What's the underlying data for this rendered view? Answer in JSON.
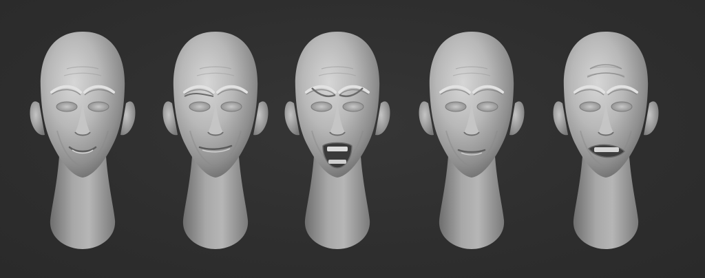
{
  "scene": {
    "background_color": "#2f2f2f",
    "material_color": "#b4b4b4",
    "heads": [
      {
        "id": "head-1",
        "expression": "smile"
      },
      {
        "id": "head-2",
        "expression": "smirk"
      },
      {
        "id": "head-3",
        "expression": "shout"
      },
      {
        "id": "head-4",
        "expression": "neutral"
      },
      {
        "id": "head-5",
        "expression": "grimace"
      }
    ]
  }
}
